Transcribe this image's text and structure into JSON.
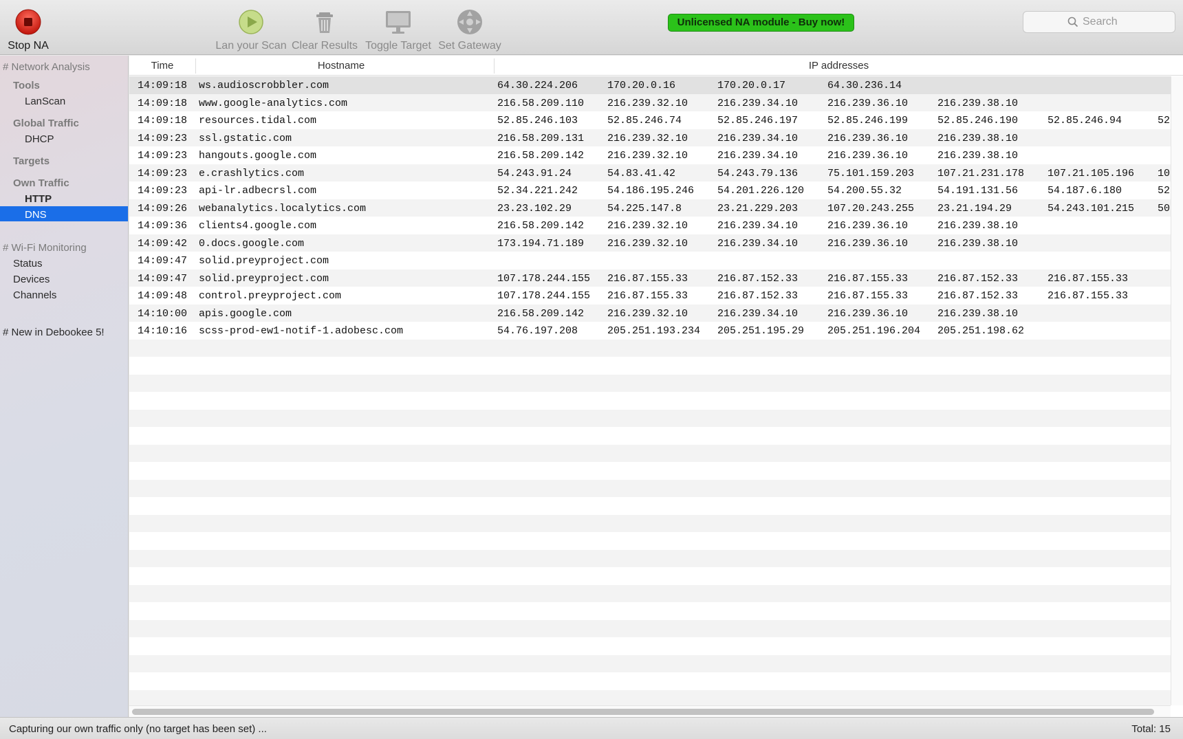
{
  "toolbar": {
    "stop_label": "Stop NA",
    "scan_label": "Lan your Scan",
    "clear_label": "Clear Results",
    "toggle_label": "Toggle Target",
    "gateway_label": "Set Gateway",
    "promo": "Unlicensed NA module - Buy now!",
    "search_placeholder": "Search"
  },
  "sidebar": {
    "network_analysis": "# Network Analysis",
    "tools": "Tools",
    "lanscan": "LanScan",
    "global_traffic": "Global Traffic",
    "dhcp": "DHCP",
    "targets": "Targets",
    "own_traffic": "Own Traffic",
    "http": "HTTP",
    "dns": "DNS",
    "wifi_monitoring": "# Wi-Fi Monitoring",
    "status": "Status",
    "devices": "Devices",
    "channels": "Channels",
    "new_in": "# New in Debookee 5!"
  },
  "table": {
    "columns": {
      "time": "Time",
      "hostname": "Hostname",
      "ips": "IP addresses"
    },
    "rows": [
      {
        "time": "14:09:18",
        "host": "ws.audioscrobbler.com",
        "ips": [
          "64.30.224.206",
          "170.20.0.16",
          "170.20.0.17",
          "64.30.236.14"
        ]
      },
      {
        "time": "14:09:18",
        "host": "www.google-analytics.com",
        "ips": [
          "216.58.209.110",
          "216.239.32.10",
          "216.239.34.10",
          "216.239.36.10",
          "216.239.38.10"
        ]
      },
      {
        "time": "14:09:18",
        "host": "resources.tidal.com",
        "ips": [
          "52.85.246.103",
          "52.85.246.74",
          "52.85.246.197",
          "52.85.246.199",
          "52.85.246.190",
          "52.85.246.94",
          "52"
        ]
      },
      {
        "time": "14:09:23",
        "host": "ssl.gstatic.com",
        "ips": [
          "216.58.209.131",
          "216.239.32.10",
          "216.239.34.10",
          "216.239.36.10",
          "216.239.38.10"
        ]
      },
      {
        "time": "14:09:23",
        "host": "hangouts.google.com",
        "ips": [
          "216.58.209.142",
          "216.239.32.10",
          "216.239.34.10",
          "216.239.36.10",
          "216.239.38.10"
        ]
      },
      {
        "time": "14:09:23",
        "host": "e.crashlytics.com",
        "ips": [
          "54.243.91.24",
          "54.83.41.42",
          "54.243.79.136",
          "75.101.159.203",
          "107.21.231.178",
          "107.21.105.196",
          "10"
        ]
      },
      {
        "time": "14:09:23",
        "host": "api-lr.adbecrsl.com",
        "ips": [
          "52.34.221.242",
          "54.186.195.246",
          "54.201.226.120",
          "54.200.55.32",
          "54.191.131.56",
          "54.187.6.180",
          "52"
        ]
      },
      {
        "time": "14:09:26",
        "host": "webanalytics.localytics.com",
        "ips": [
          "23.23.102.29",
          "54.225.147.8",
          "23.21.229.203",
          "107.20.243.255",
          "23.21.194.29",
          "54.243.101.215",
          "50"
        ]
      },
      {
        "time": "14:09:36",
        "host": "clients4.google.com",
        "ips": [
          "216.58.209.142",
          "216.239.32.10",
          "216.239.34.10",
          "216.239.36.10",
          "216.239.38.10"
        ]
      },
      {
        "time": "14:09:42",
        "host": "0.docs.google.com",
        "ips": [
          "173.194.71.189",
          "216.239.32.10",
          "216.239.34.10",
          "216.239.36.10",
          "216.239.38.10"
        ]
      },
      {
        "time": "14:09:47",
        "host": "solid.preyproject.com",
        "ips": []
      },
      {
        "time": "14:09:47",
        "host": "solid.preyproject.com",
        "ips": [
          "107.178.244.155",
          "216.87.155.33",
          "216.87.152.33",
          "216.87.155.33",
          "216.87.152.33",
          "216.87.155.33"
        ]
      },
      {
        "time": "14:09:48",
        "host": "control.preyproject.com",
        "ips": [
          "107.178.244.155",
          "216.87.155.33",
          "216.87.152.33",
          "216.87.155.33",
          "216.87.152.33",
          "216.87.155.33"
        ]
      },
      {
        "time": "14:10:00",
        "host": "apis.google.com",
        "ips": [
          "216.58.209.142",
          "216.239.32.10",
          "216.239.34.10",
          "216.239.36.10",
          "216.239.38.10"
        ]
      },
      {
        "time": "14:10:16",
        "host": "scss-prod-ew1-notif-1.adobesc.com",
        "ips": [
          "54.76.197.208",
          "205.251.193.234",
          "205.251.195.29",
          "205.251.196.204",
          "205.251.198.62"
        ]
      }
    ]
  },
  "statusbar": {
    "message": "Capturing our own traffic only (no target has been set) ...",
    "total": "Total: 15"
  },
  "colors": {
    "accent": "#1a6ee8",
    "promo": "#2bc21a",
    "stop": "#e0271c"
  }
}
